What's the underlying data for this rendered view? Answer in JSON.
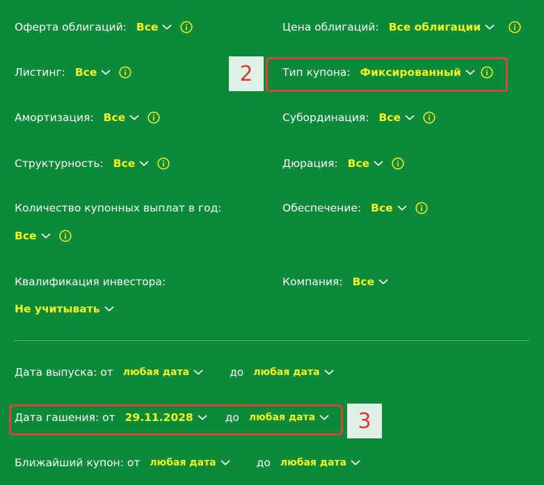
{
  "filters": {
    "oferta": {
      "label": "Оферта облигаций:",
      "value": "Все"
    },
    "price": {
      "label": "Цена облигаций:",
      "value": "Все облигации"
    },
    "listing": {
      "label": "Листинг:",
      "value": "Все"
    },
    "coupon_type": {
      "label": "Тип купона:",
      "value": "Фиксированный"
    },
    "amortization": {
      "label": "Амортизация:",
      "value": "Все"
    },
    "subordination": {
      "label": "Субординация:",
      "value": "Все"
    },
    "structured": {
      "label": "Структурность:",
      "value": "Все"
    },
    "duration": {
      "label": "Дюрация:",
      "value": "Все"
    },
    "coupons_per_year": {
      "label": "Количество купонных выплат в год:",
      "value": "Все"
    },
    "collateral": {
      "label": "Обеспечение:",
      "value": "Все"
    },
    "qualification": {
      "label": "Квалификация инвестора:",
      "value": "Не учитывать"
    },
    "company": {
      "label": "Компания:",
      "value": "Все"
    }
  },
  "dates": {
    "issue": {
      "label": "Дата выпуска: от",
      "from": "любая дата",
      "to_label": "до",
      "to": "любая дата"
    },
    "maturity": {
      "label": "Дата гашения: от",
      "from": "29.11.2028",
      "to_label": "до",
      "to": "любая дата"
    },
    "next_coupon": {
      "label": "Ближайший купон: от",
      "from": "любая дата",
      "to_label": "до",
      "to": "любая дата"
    }
  },
  "badges": {
    "coupon_type": "2",
    "maturity": "3"
  },
  "colors": {
    "background": "#0b8a3a",
    "value": "#f7f325",
    "highlight": "#d9433a",
    "badge_bg": "#dff0e4"
  },
  "icons": {
    "chevron": "chevron-down-icon",
    "info": "info-icon"
  }
}
